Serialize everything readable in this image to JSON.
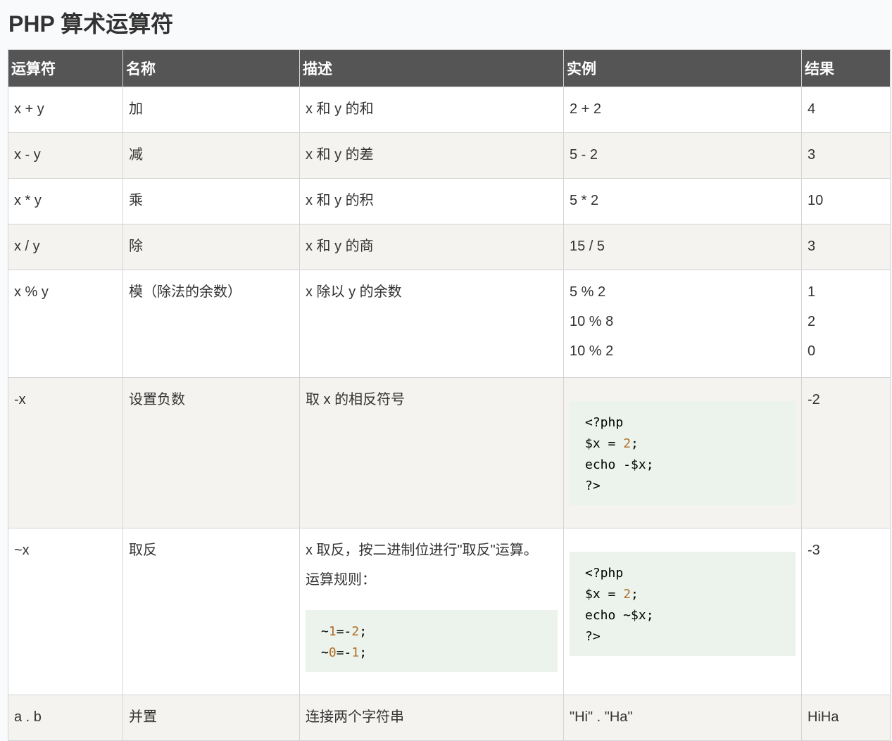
{
  "title": "PHP 算术运算符",
  "headers": [
    "运算符",
    "名称",
    "描述",
    "实例",
    "结果"
  ],
  "rows": [
    {
      "operator": "x + y",
      "name": "加",
      "description": "x 和 y 的和",
      "example": "2 + 2",
      "result": "4"
    },
    {
      "operator": "x - y",
      "name": "减",
      "description": "x 和 y 的差",
      "example": "5 - 2",
      "result": "3"
    },
    {
      "operator": "x * y",
      "name": "乘",
      "description": "x 和 y 的积",
      "example": "5 * 2",
      "result": "10"
    },
    {
      "operator": "x / y",
      "name": "除",
      "description": "x 和 y 的商",
      "example": "15 / 5",
      "result": "3"
    },
    {
      "operator": "x % y",
      "name": "模（除法的余数）",
      "description": "x 除以 y 的余数",
      "examples": [
        "5 % 2",
        "10 % 8",
        "10 % 2"
      ],
      "results": [
        "1",
        "2",
        "0"
      ]
    },
    {
      "operator": "-x",
      "name": "设置负数",
      "description": "取 x 的相反符号",
      "code": [
        "<?php",
        "$x = 2;",
        "echo -$x;",
        "?>"
      ],
      "result": "-2"
    },
    {
      "operator": "~x",
      "name": "取反",
      "description": "x 取反，按二进制位进行\"取反\"运算。",
      "rule_label": "运算规则：",
      "rule_code": [
        "~1=-2;",
        "~0=-1;"
      ],
      "code": [
        "<?php",
        "$x = 2;",
        "echo ~$x;",
        "?>"
      ],
      "result": "-3"
    },
    {
      "operator": "a . b",
      "name": "并置",
      "description": "连接两个字符串",
      "example": "\"Hi\" . \"Ha\"",
      "result": "HiHa"
    }
  ],
  "colors": {
    "header_bg": "#555555",
    "row_alt_bg": "#f4f3ef",
    "code_bg": "#ebf3ec",
    "code_number": "#b06f2a"
  }
}
